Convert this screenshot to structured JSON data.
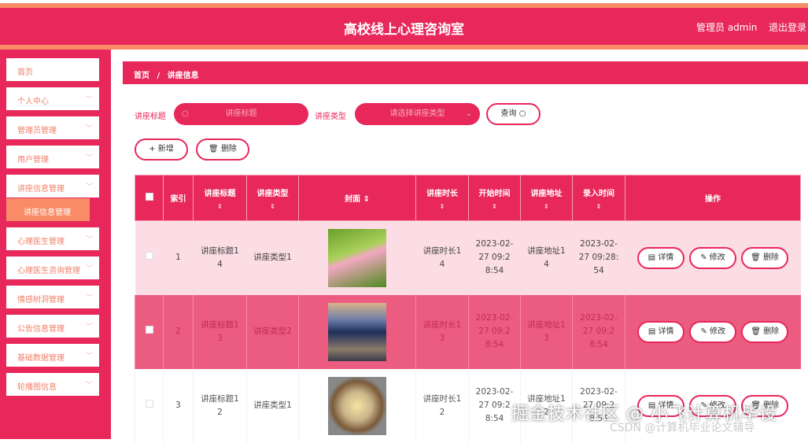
{
  "header": {
    "title": "高校线上心理咨询室",
    "user": "管理员 admin",
    "logout": "退出登录"
  },
  "sidebar": {
    "items": [
      {
        "label": "首页"
      },
      {
        "label": "个人中心"
      },
      {
        "label": "管理员管理"
      },
      {
        "label": "用户管理"
      },
      {
        "label": "讲座信息管理"
      },
      {
        "label": "心理医生管理"
      },
      {
        "label": "心理医生咨询管理"
      },
      {
        "label": "情感树洞管理"
      },
      {
        "label": "公告信息管理"
      },
      {
        "label": "基础数据管理"
      },
      {
        "label": "轮播图信息"
      }
    ],
    "active_sub": "讲座信息管理"
  },
  "breadcrumb": {
    "home": "首页",
    "sep": "/",
    "current": "讲座信息"
  },
  "search": {
    "title_label": "讲座标题",
    "title_placeholder": "讲座标题",
    "type_label": "讲座类型",
    "type_placeholder": "请选择讲座类型",
    "query": "查询"
  },
  "actions": {
    "add": "新增",
    "delete": "删除"
  },
  "table": {
    "columns": [
      "索引",
      "讲座标题",
      "讲座类型",
      "封面",
      "讲座时长",
      "开始时间",
      "讲座地址",
      "录入时间",
      "操作"
    ],
    "rows": [
      {
        "index": "1",
        "title": "讲座标题14",
        "type": "讲座类型1",
        "duration": "讲座时长14",
        "start": "2023-02-27 09:28:54",
        "address": "讲座地址14",
        "entry": "2023-02-27 09:28:54"
      },
      {
        "index": "2",
        "title": "讲座标题13",
        "type": "讲座类型2",
        "duration": "讲座时长13",
        "start": "2023-02-27 09:28:54",
        "address": "讲座地址13",
        "entry": "2023-02-27 09:28:54"
      },
      {
        "index": "3",
        "title": "讲座标题12",
        "type": "讲座类型1",
        "duration": "讲座时长12",
        "start": "2023-02-27 09:28:54",
        "address": "讲座地址12",
        "entry": "2023-02-27 09:28:54"
      }
    ],
    "row_actions": {
      "detail": "详情",
      "edit": "修改",
      "delete": "删除"
    }
  },
  "watermark": {
    "main": "掘金技术社区 @ 小飞计算机毕设",
    "sub": "CSDN @计算机毕业论文辅导"
  }
}
